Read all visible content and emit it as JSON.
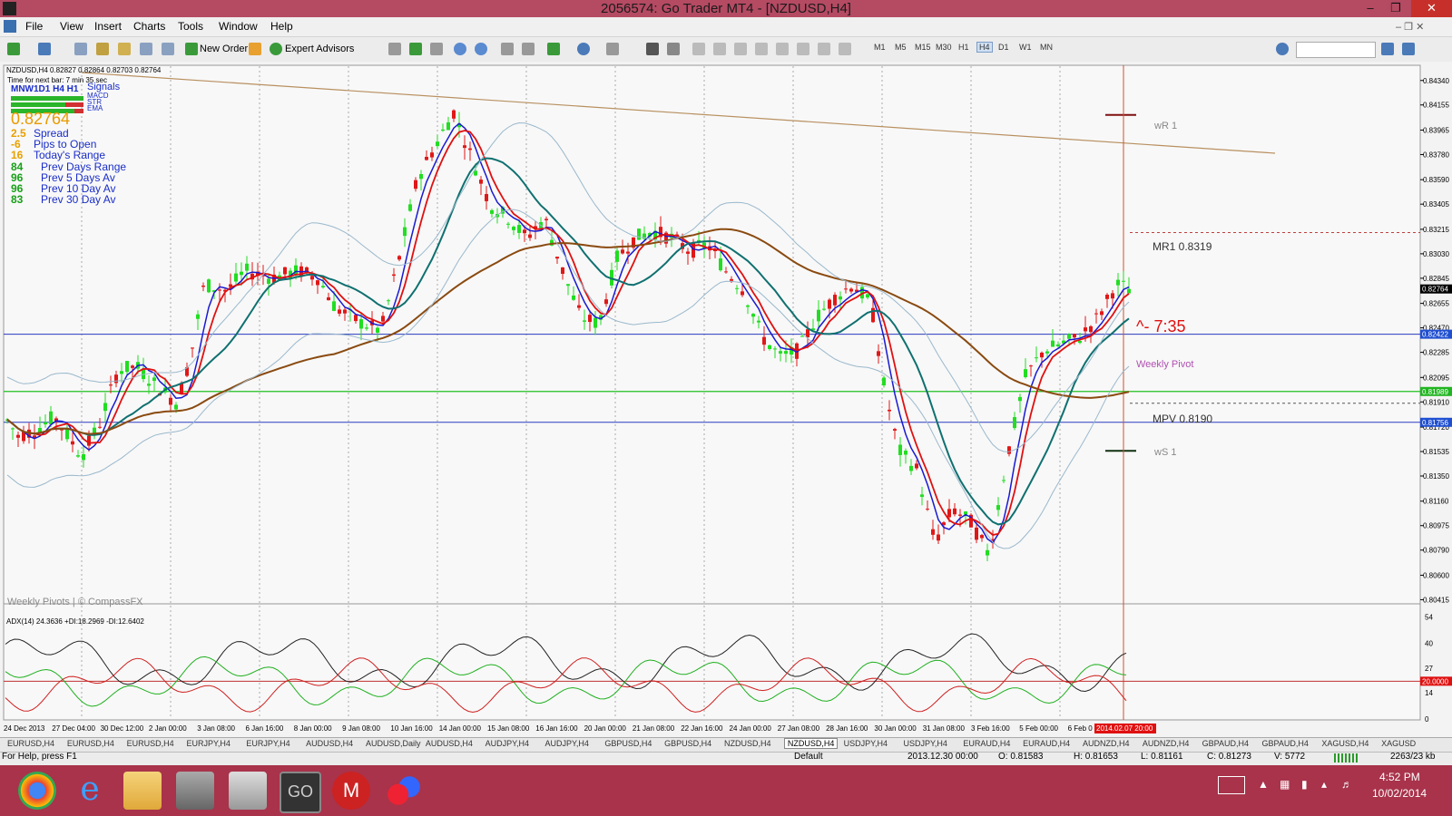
{
  "window": {
    "title": "2056574: Go Trader MT4 - [NZDUSD,H4]"
  },
  "menu": [
    "File",
    "View",
    "Insert",
    "Charts",
    "Tools",
    "Window",
    "Help"
  ],
  "toolbar": {
    "new_order": "New Order",
    "expert_advisors": "Expert Advisors",
    "timeframes": [
      "M1",
      "M5",
      "M15",
      "M30",
      "H1",
      "H4",
      "D1",
      "W1",
      "MN"
    ],
    "active_timeframe": "H4"
  },
  "chart": {
    "header": "NZDUSD,H4 0.82827 0.82864 0.82703 0.82764",
    "time_next_bar": "Time for next bar: 7 min 35 sec",
    "signals_head": "MNW1D1 H4 H1",
    "signals_label": "Signals",
    "signals_rows": [
      "MACD",
      "STR",
      "EMA"
    ],
    "big_price": "0.82764",
    "stats": [
      {
        "v": "2.5",
        "label": "Spread",
        "c": "#e8a000"
      },
      {
        "v": "-6",
        "label": "Pips to Open",
        "c": "#e8a000"
      },
      {
        "v": "16",
        "label": "Today's Range",
        "c": "#e8a000"
      },
      {
        "v": "84",
        "label": "Prev Days Range",
        "c": "#18a018"
      },
      {
        "v": "96",
        "label": "Prev 5 Days Av",
        "c": "#18a018"
      },
      {
        "v": "96",
        "label": "Prev 10 Day Av",
        "c": "#18a018"
      },
      {
        "v": "83",
        "label": "Prev 30 Day Av",
        "c": "#18a018"
      }
    ],
    "watermark": "Weekly Pivots | © CompassFX",
    "countdown": "^- 7:35",
    "pivots": {
      "wr1": "wR 1",
      "mr1": "MR1  0.8319",
      "weekly_pivot": "Weekly Pivot",
      "mpv": "MPV  0.8190",
      "ws1": "wS 1"
    },
    "price_axis": [
      "0.84340",
      "0.84155",
      "0.83965",
      "0.83780",
      "0.83590",
      "0.83405",
      "0.83215",
      "0.83030",
      "0.82845",
      "0.82655",
      "0.82470",
      "0.82285",
      "0.82095",
      "0.81910",
      "0.81720",
      "0.81535",
      "0.81350",
      "0.81160",
      "0.80975",
      "0.80790",
      "0.80600",
      "0.80415"
    ],
    "price_tags": [
      {
        "v": "0.82764",
        "bg": "#000000",
        "y": 0.82764
      },
      {
        "v": "0.82422",
        "bg": "#1f4fd1",
        "y": 0.82422
      },
      {
        "v": "0.81989",
        "bg": "#21b521",
        "y": 0.81989
      },
      {
        "v": "0.81756",
        "bg": "#1f4fd1",
        "y": 0.81756
      }
    ],
    "adx_label": "ADX(14) 24.3636 +DI:18.2969 -DI:12.6402",
    "adx_axis": [
      "54",
      "40",
      "27",
      "14",
      "0"
    ],
    "adx_tag": "20.0000",
    "time_axis": [
      "24 Dec 2013",
      "27 Dec 04:00",
      "30 Dec 12:00",
      "2 Jan 00:00",
      "3 Jan 08:00",
      "6 Jan 16:00",
      "8 Jan 00:00",
      "9 Jan 08:00",
      "10 Jan 16:00",
      "14 Jan 00:00",
      "15 Jan 08:00",
      "16 Jan 16:00",
      "20 Jan 00:00",
      "21 Jan 08:00",
      "22 Jan 16:00",
      "24 Jan 00:00",
      "27 Jan 08:00",
      "28 Jan 16:00",
      "30 Jan 00:00",
      "31 Jan 08:00",
      "3 Feb 16:00",
      "5 Feb 00:00",
      "6 Feb 0"
    ],
    "time_tag": "2014.02.07 20:00"
  },
  "tabs": [
    "EURUSD,H4",
    "EURUSD,H4",
    "EURUSD,H4",
    "EURJPY,H4",
    "EURJPY,H4",
    "AUDUSD,H4",
    "AUDUSD,Daily",
    "AUDUSD,H4",
    "AUDJPY,H4",
    "AUDJPY,H4",
    "GBPUSD,H4",
    "GBPUSD,H4",
    "NZDUSD,H4",
    "NZDUSD,H4",
    "USDJPY,H4",
    "USDJPY,H4",
    "EURAUD,H4",
    "EURAUD,H4",
    "AUDNZD,H4",
    "AUDNZD,H4",
    "GBPAUD,H4",
    "GBPAUD,H4",
    "XAGUSD,H4",
    "XAGUSD"
  ],
  "active_tab_index": 13,
  "status": {
    "help": "For Help, press F1",
    "profile": "Default",
    "date": "2013.12.30 00:00",
    "open": "O: 0.81583",
    "high": "H: 0.81653",
    "low": "L: 0.81161",
    "close": "C: 0.81273",
    "volume": "V: 5772",
    "traffic": "2263/23 kb"
  },
  "clock": {
    "time": "4:52 PM",
    "date": "10/02/2014"
  },
  "taskbar_apps": [
    "chrome-icon",
    "ie-icon",
    "folder-icon",
    "printer-icon",
    "calculator-icon",
    "go-trader-icon",
    "mt-icon",
    "app-icon"
  ]
}
